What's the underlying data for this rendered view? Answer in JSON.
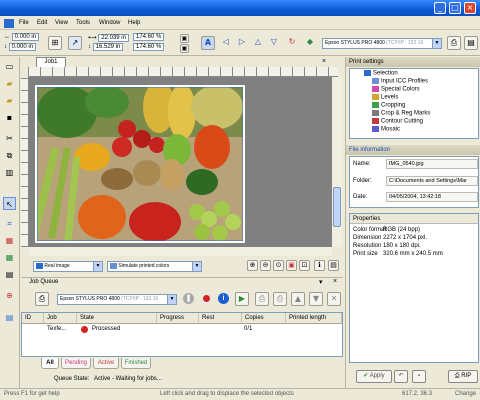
{
  "titlebar": {
    "controls": [
      "_",
      "□",
      "×"
    ]
  },
  "menu": [
    "File",
    "Edit",
    "View",
    "Tools",
    "Window",
    "Help"
  ],
  "toolbar": {
    "x_pos": "0.000 in",
    "y_pos": "0.000 in",
    "width": "22.039 in",
    "height": "16.529 in",
    "scale_w": "174.60 %",
    "scale_h": "174.60 %",
    "printer": "Epson STYLUS PRO 4800",
    "printer_ghost": "(TCP/IP : 192.16"
  },
  "document": {
    "tab_label": "Job1",
    "view_mode": "Real image",
    "simulate": "Simulate printed colors"
  },
  "job_queue": {
    "title": "Job Queue",
    "printer": "Epson STYLUS PRO 4800",
    "printer_ghost": "(TCP/IP : 192.16",
    "columns": [
      "ID",
      "Job",
      "State",
      "Progress",
      "Rest",
      "Copies",
      "Printed length"
    ],
    "rows": [
      {
        "job": "Tex­fe...",
        "state": "Processed",
        "copies": "0/1"
      }
    ],
    "tabs": [
      "All",
      "Pending",
      "Active",
      "Finished"
    ],
    "state_label": "Queue State:",
    "state_value": "Active - Waiting for jobs..."
  },
  "print_settings": {
    "title": "Print settings",
    "items": [
      {
        "label": "Selection",
        "level": 0,
        "color": "#2a6bd1"
      },
      {
        "label": "Input ICC Profiles",
        "level": 1,
        "color": "#6b8fd1"
      },
      {
        "label": "Special Colors",
        "level": 1,
        "color": "#d14ab0"
      },
      {
        "label": "Levels",
        "level": 1,
        "color": "#d1a52a"
      },
      {
        "label": "Cropping",
        "level": 1,
        "color": "#3aa14a"
      },
      {
        "label": "Crop & Reg Marks",
        "level": 1,
        "color": "#7a7a7a"
      },
      {
        "label": "Contour Cutting",
        "level": 1,
        "color": "#c43a3a"
      },
      {
        "label": "Mosaic",
        "level": 1,
        "color": "#5a5ad1"
      }
    ]
  },
  "file_info": {
    "title": "File information",
    "name_label": "Name:",
    "name_value": "IMG_0540.jpg",
    "folder_label": "Folder:",
    "folder_value": "C:\\Documents and Settings\\Mar",
    "date_label": "Date:",
    "date_value": "04/05/2004, 13:42:18"
  },
  "properties": {
    "title": "Properties",
    "rows": [
      {
        "k": "Color format",
        "v": "RGB (24 bpp)"
      },
      {
        "k": "Dimension",
        "v": "2272 x 1704 pxl."
      },
      {
        "k": "Resolution",
        "v": "180 x 180 dpi."
      },
      {
        "k": "Print size",
        "v": "320.6 mm x 240.5 mm"
      }
    ]
  },
  "panel_buttons": {
    "apply": "Apply",
    "rip": "RIP"
  },
  "statusbar": {
    "left": "Press F1 for get help",
    "center": "Left click and drag to displace the selected objects",
    "coords": "617.2, 36.3",
    "right": "Change"
  }
}
